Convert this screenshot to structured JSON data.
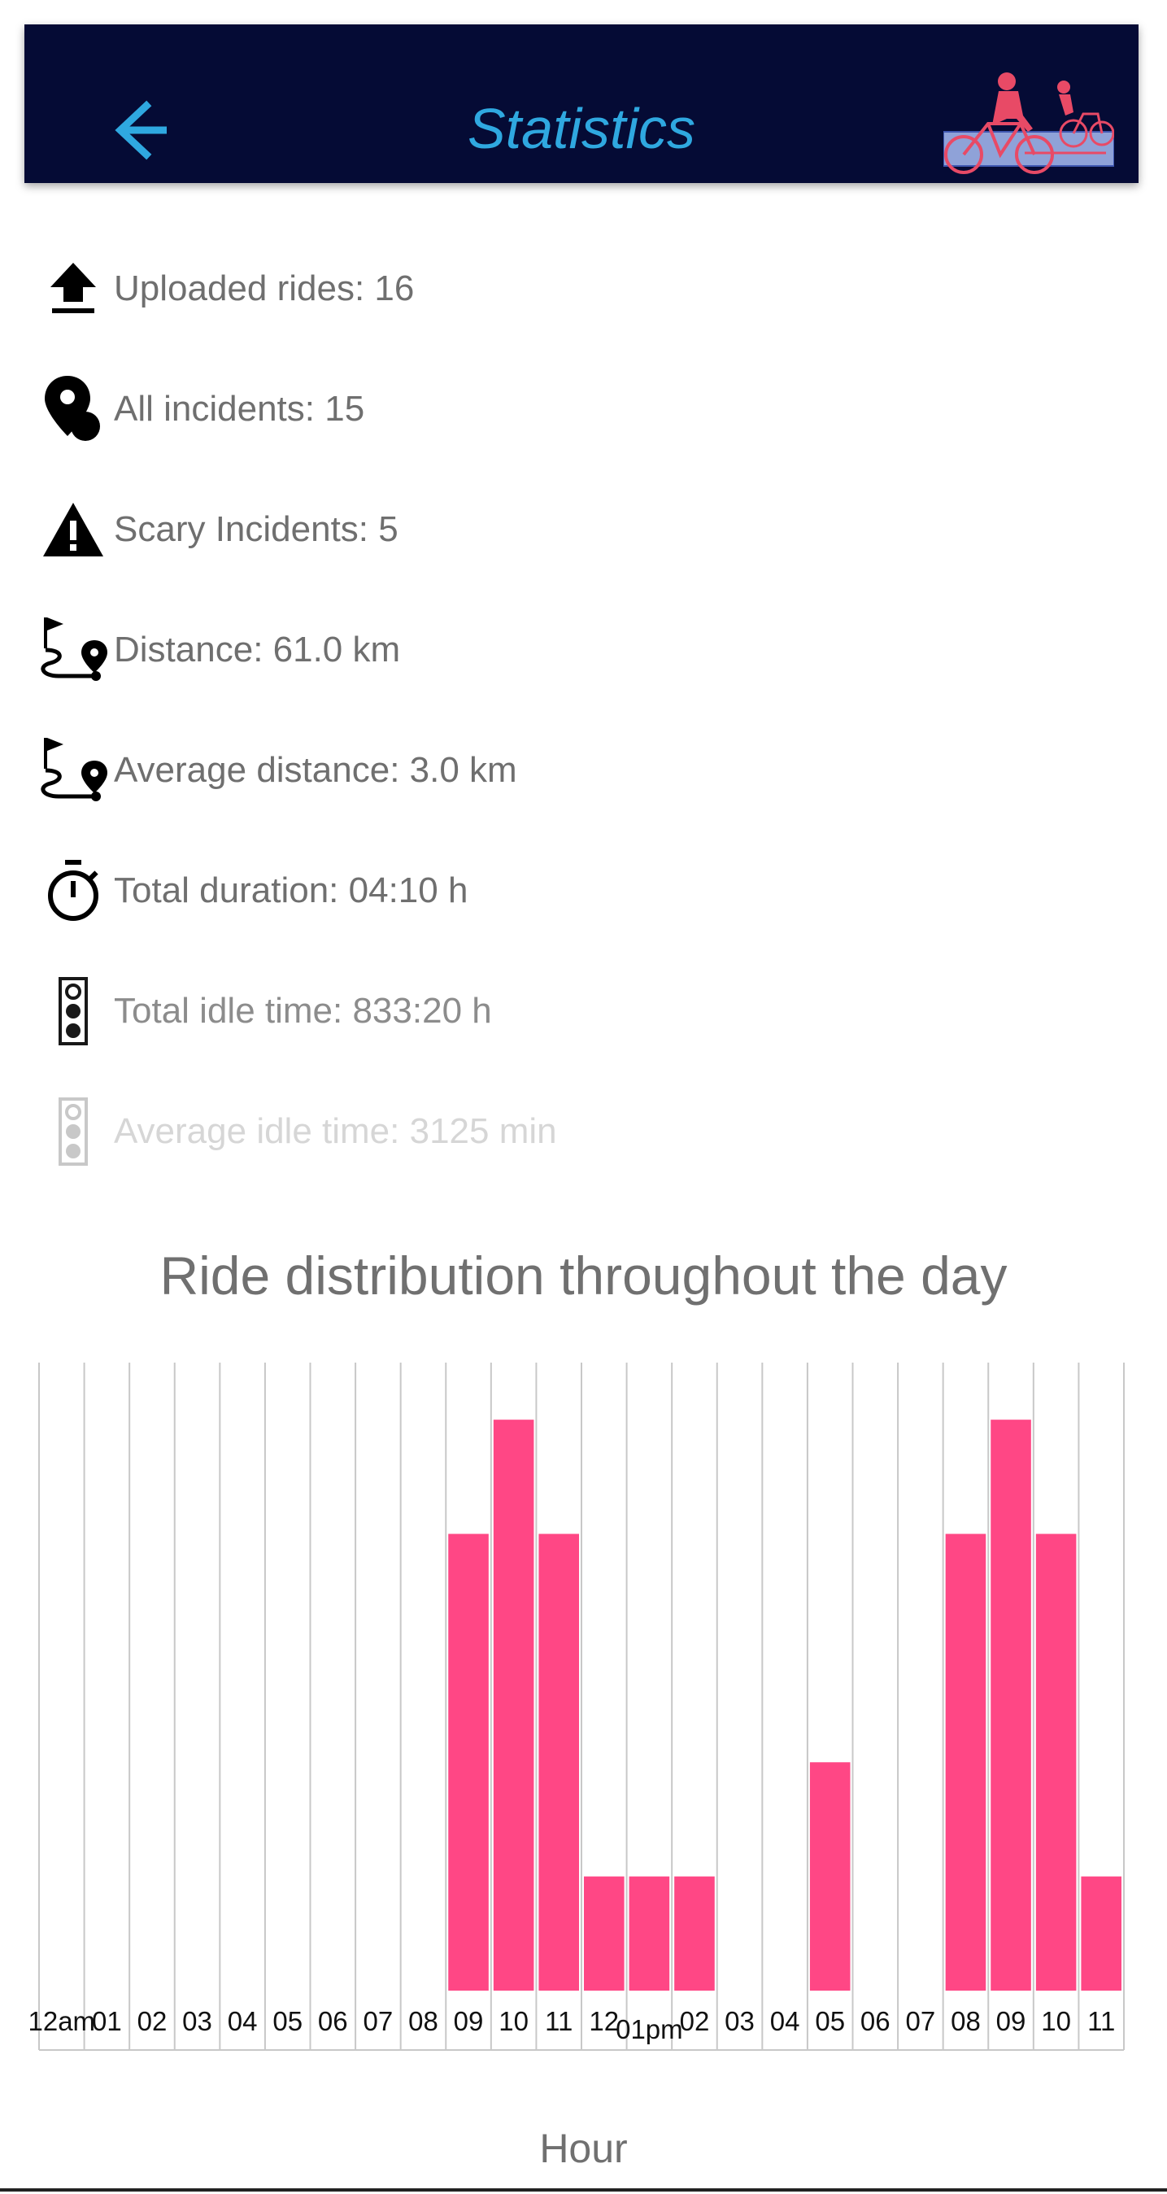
{
  "appbar": {
    "title": "Statistics",
    "back_icon": "arrow-left-icon",
    "logo_icon": "cyclists-logo-icon",
    "background": "#050b35",
    "accent": "#2fa8e0"
  },
  "stats": [
    {
      "label": "Uploaded rides: 16",
      "icon": "upload-icon"
    },
    {
      "label": "All incidents: 15",
      "icon": "map-pin-icon"
    },
    {
      "label": "Scary Incidents: 5",
      "icon": "warning-icon"
    },
    {
      "label": "Distance: 61.0 km",
      "icon": "route-icon"
    },
    {
      "label": "Average distance: 3.0 km",
      "icon": "route-icon"
    },
    {
      "label": "Total duration: 04:10 h",
      "icon": "stopwatch-icon"
    },
    {
      "label": "Total idle time: 833:20 h",
      "icon": "traffic-light-icon"
    },
    {
      "label": "Average idle time: 3125 min",
      "icon": "traffic-light-icon"
    }
  ],
  "chart_data": {
    "type": "bar",
    "title": "Ride distribution throughout the day",
    "xlabel": "Hour",
    "ylabel": "",
    "categories": [
      "12am",
      "01",
      "02",
      "03",
      "04",
      "05",
      "06",
      "07",
      "08",
      "09",
      "10",
      "11",
      "12",
      "01pm",
      "02",
      "03",
      "04",
      "05",
      "06",
      "07",
      "08",
      "09",
      "10",
      "11"
    ],
    "values": [
      0,
      0,
      0,
      0,
      0,
      0,
      0,
      0,
      0,
      4,
      5,
      4,
      1,
      1,
      1,
      0,
      0,
      2,
      0,
      0,
      4,
      5,
      4,
      1
    ],
    "ylim": [
      0,
      5.5
    ],
    "grid": "vertical",
    "bar_color": "#ff4785"
  }
}
